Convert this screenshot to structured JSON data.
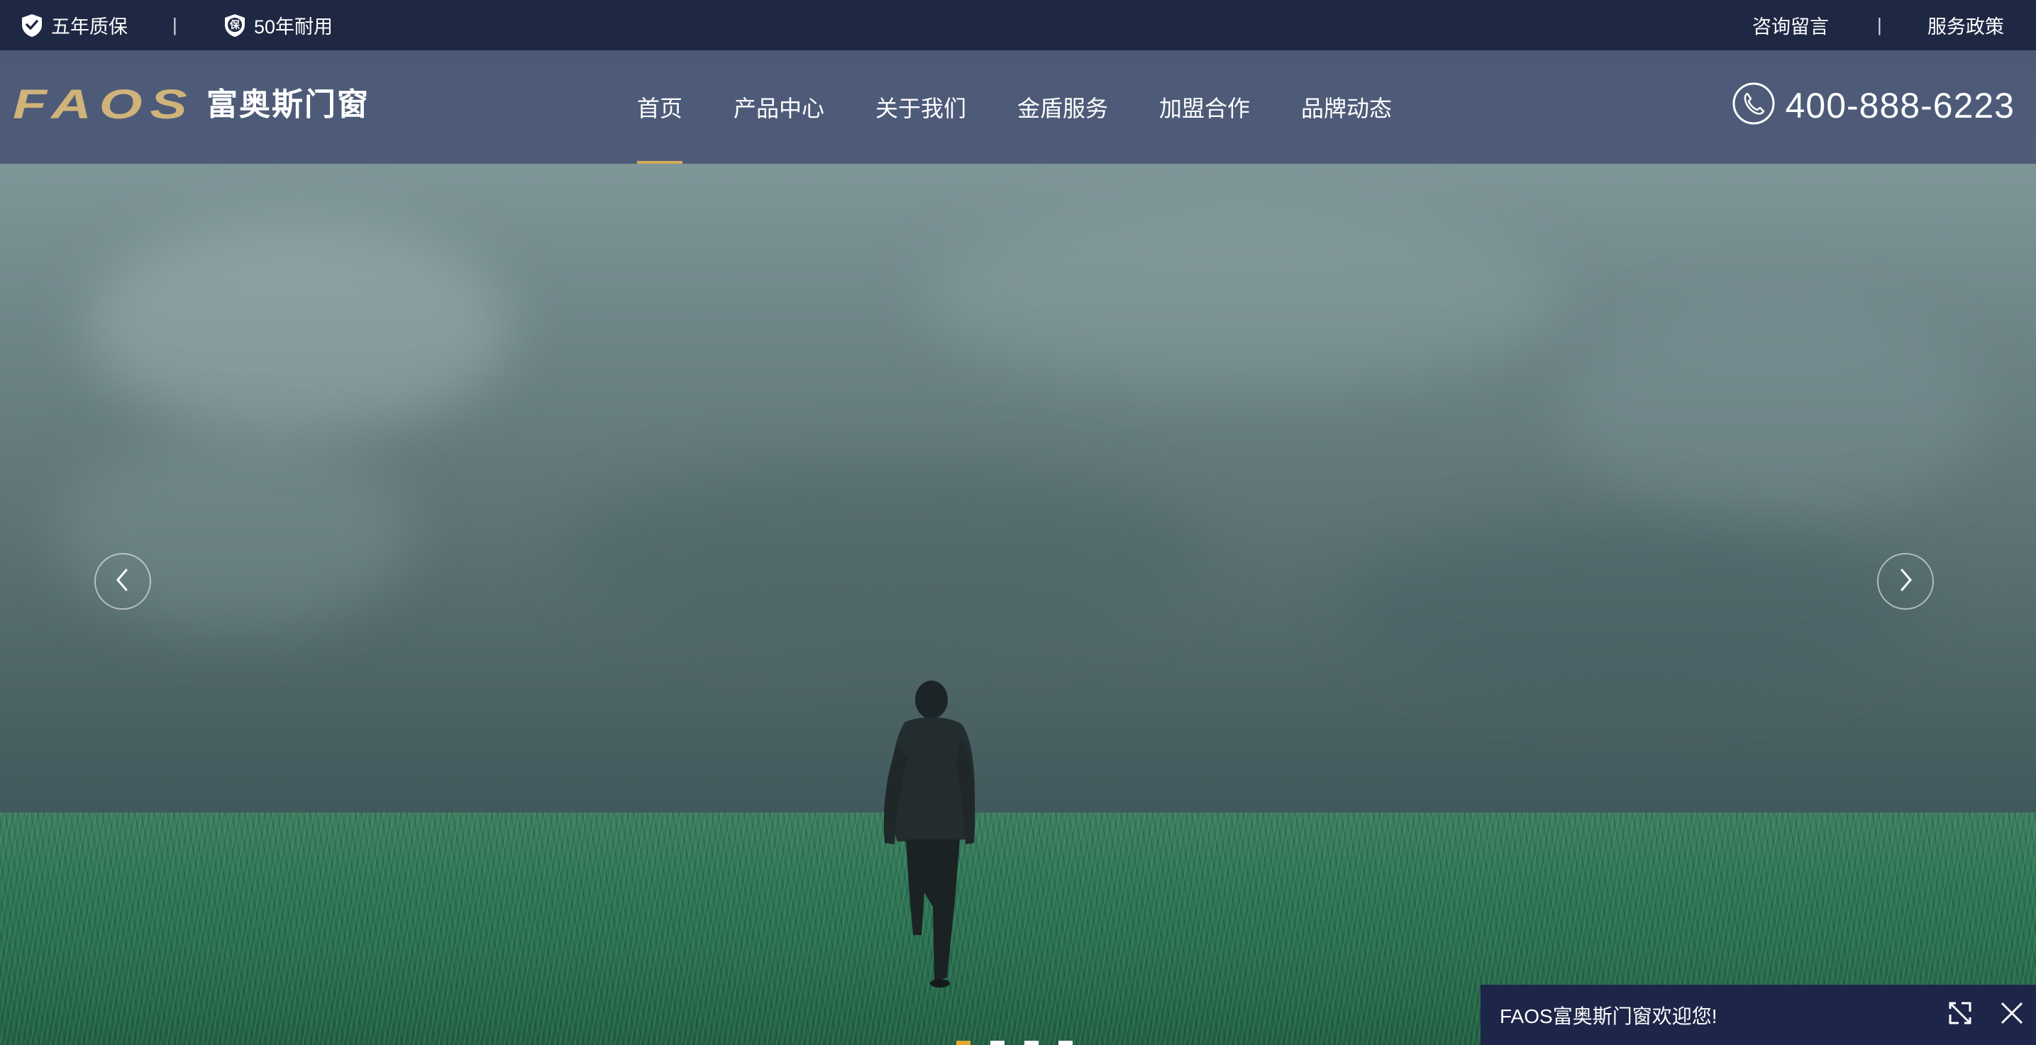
{
  "topbar": {
    "left": [
      {
        "icon": "shield-check-icon",
        "label": "五年质保"
      },
      {
        "icon": "shield-badge-icon",
        "label": "50年耐用"
      }
    ],
    "badge_char": "保",
    "separator": "|",
    "right": [
      "咨询留言",
      "服务政策"
    ]
  },
  "logo": {
    "latin": "FAOS",
    "chinese": "富奥斯门窗"
  },
  "nav": {
    "items": [
      "首页",
      "产品中心",
      "关于我们",
      "金盾服务",
      "加盟合作",
      "品牌动态"
    ],
    "active_index": 0
  },
  "phone": {
    "icon": "phone-icon",
    "number": "400-888-6223"
  },
  "hero": {
    "prev_icon": "chevron-left-icon",
    "next_icon": "chevron-right-icon",
    "slide_count": 4,
    "active_slide": 0
  },
  "chat": {
    "message": "FAOS富奥斯门窗欢迎您!",
    "expand_icon": "expand-icon",
    "close_icon": "close-icon"
  },
  "colors": {
    "topbar_bg": "#1f2843",
    "navbar_bg": "#4e5b77",
    "accent_gold": "#d4a85a",
    "logo_gold": "#cfb37a",
    "chat_bg": "#1d2548"
  }
}
